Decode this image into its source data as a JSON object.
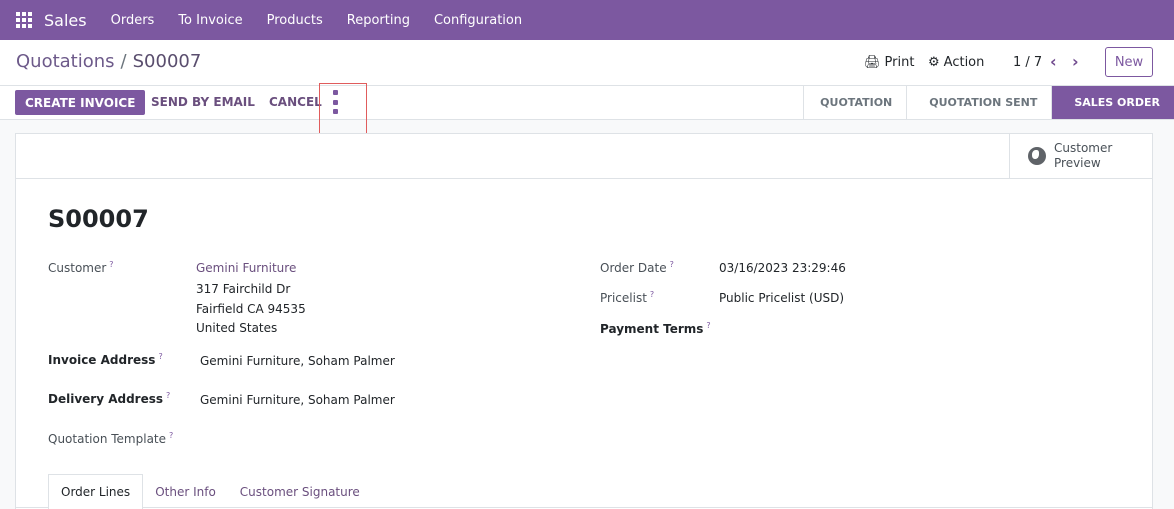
{
  "navbar": {
    "app_name": "Sales",
    "menu": [
      "Orders",
      "To Invoice",
      "Products",
      "Reporting",
      "Configuration"
    ]
  },
  "control": {
    "breadcrumb_parent": "Quotations",
    "breadcrumb_separator": "/",
    "breadcrumb_current": "S00007",
    "print_label": "Print",
    "action_label": "Action",
    "pager": "1 / 7",
    "new_label": "New"
  },
  "statusbar": {
    "create_invoice": "CREATE INVOICE",
    "send_by_email": "SEND BY EMAIL",
    "cancel": "CANCEL",
    "stages": [
      "QUOTATION",
      "QUOTATION SENT",
      "SALES ORDER"
    ],
    "active_stage": "SALES ORDER"
  },
  "sheet": {
    "customer_preview": [
      "Customer",
      "Preview"
    ],
    "order_name": "S00007",
    "fields": {
      "customer_label": "Customer",
      "customer_name": "Gemini Furniture",
      "customer_address": [
        "317 Fairchild Dr",
        "Fairfield CA 94535",
        "United States"
      ],
      "invoice_address_label": "Invoice Address",
      "invoice_address": "Gemini Furniture, Soham Palmer",
      "delivery_address_label": "Delivery Address",
      "delivery_address": "Gemini Furniture, Soham Palmer",
      "quotation_template_label": "Quotation Template",
      "order_date_label": "Order Date",
      "order_date": "03/16/2023 23:29:46",
      "pricelist_label": "Pricelist",
      "pricelist": "Public Pricelist (USD)",
      "payment_terms_label": "Payment Terms",
      "help_mark": "?"
    },
    "tabs": [
      "Order Lines",
      "Other Info",
      "Customer Signature"
    ]
  }
}
